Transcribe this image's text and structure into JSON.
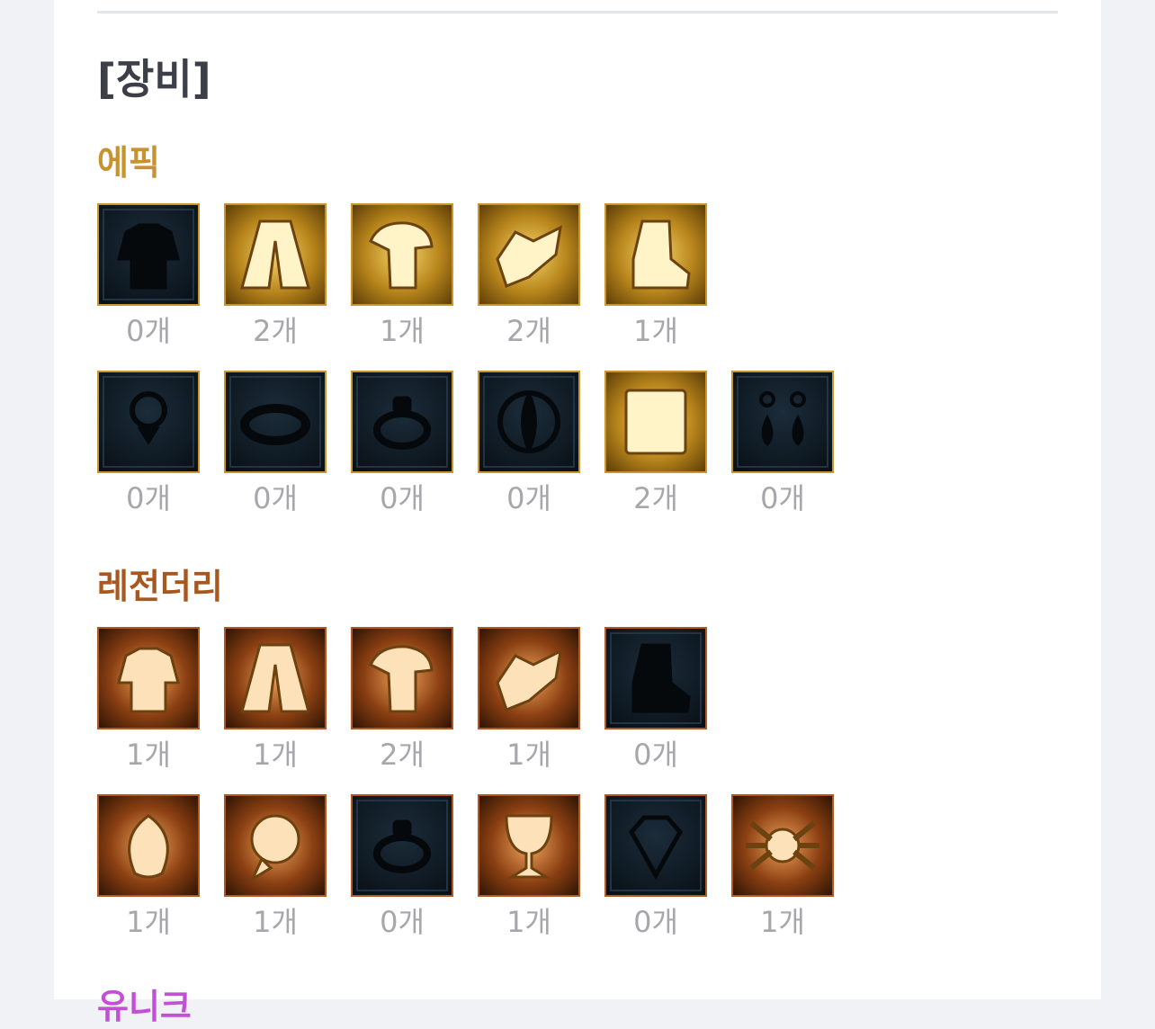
{
  "section_title": "[장비]",
  "epic": {
    "label": "에픽",
    "rows": [
      [
        {
          "icon": "top-armor-silhouette-icon",
          "count": "0개",
          "filled": false
        },
        {
          "icon": "bottom-armor-icon",
          "count": "2개",
          "filled": true
        },
        {
          "icon": "shoulder-armor-icon",
          "count": "1개",
          "filled": true
        },
        {
          "icon": "belt-armor-icon",
          "count": "2개",
          "filled": true
        },
        {
          "icon": "shoes-armor-icon",
          "count": "1개",
          "filled": true
        }
      ],
      [
        {
          "icon": "necklace-silhouette-icon",
          "count": "0개",
          "filled": false
        },
        {
          "icon": "bracelet-silhouette-icon",
          "count": "0개",
          "filled": false
        },
        {
          "icon": "ring-silhouette-icon",
          "count": "0개",
          "filled": false
        },
        {
          "icon": "support-silhouette-icon",
          "count": "0개",
          "filled": false
        },
        {
          "icon": "magic-stone-book-icon",
          "count": "2개",
          "filled": true
        },
        {
          "icon": "earring-silhouette-icon",
          "count": "0개",
          "filled": false
        }
      ]
    ]
  },
  "legend": {
    "label": "레전더리",
    "rows": [
      [
        {
          "icon": "top-armor-icon",
          "count": "1개",
          "filled": true
        },
        {
          "icon": "bottom-armor-icon",
          "count": "1개",
          "filled": true
        },
        {
          "icon": "shoulder-armor-icon",
          "count": "2개",
          "filled": true
        },
        {
          "icon": "belt-armor-icon",
          "count": "1개",
          "filled": true
        },
        {
          "icon": "shoes-silhouette-icon",
          "count": "0개",
          "filled": false
        }
      ],
      [
        {
          "icon": "leaf-necklace-icon",
          "count": "1개",
          "filled": true
        },
        {
          "icon": "rose-bracelet-icon",
          "count": "1개",
          "filled": true
        },
        {
          "icon": "ring-silhouette-icon",
          "count": "0개",
          "filled": false
        },
        {
          "icon": "goblet-support-icon",
          "count": "1개",
          "filled": true
        },
        {
          "icon": "gem-silhouette-icon",
          "count": "0개",
          "filled": false
        },
        {
          "icon": "spider-earring-icon",
          "count": "1개",
          "filled": true
        }
      ]
    ]
  },
  "unique": {
    "label": "유니크"
  }
}
